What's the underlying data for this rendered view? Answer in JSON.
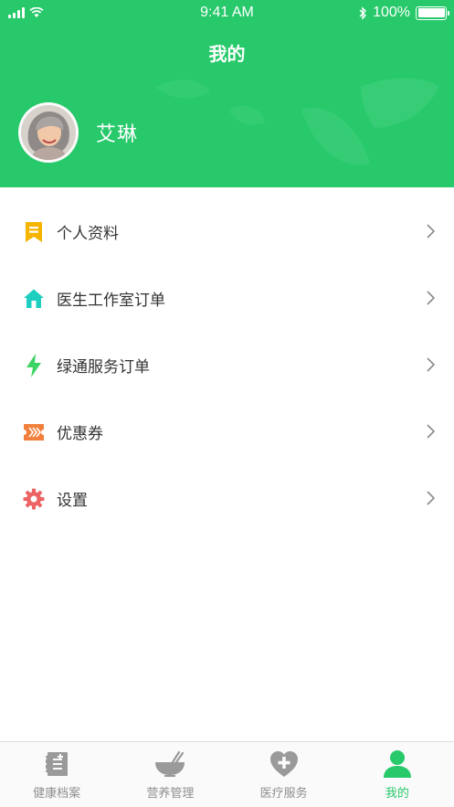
{
  "status_bar": {
    "time": "9:41 AM",
    "battery": "100%"
  },
  "header": {
    "title": "我的"
  },
  "profile": {
    "name": "艾琳"
  },
  "menu": [
    {
      "label": "个人资料",
      "icon": "bookmark-icon",
      "color": "#f5b400"
    },
    {
      "label": "医生工作室订单",
      "icon": "house-icon",
      "color": "#1ecfc0"
    },
    {
      "label": "绿通服务订单",
      "icon": "lightning-icon",
      "color": "#3ed463"
    },
    {
      "label": "优惠券",
      "icon": "ticket-icon",
      "color": "#f27f3c"
    },
    {
      "label": "设置",
      "icon": "gear-icon",
      "color": "#ec6464"
    }
  ],
  "tabbar": [
    {
      "label": "健康档案",
      "icon": "health-record-icon",
      "active": false
    },
    {
      "label": "营养管理",
      "icon": "bowl-icon",
      "active": false
    },
    {
      "label": "医疗服务",
      "icon": "medical-heart-icon",
      "active": false
    },
    {
      "label": "我的",
      "icon": "person-icon",
      "active": true
    }
  ],
  "colors": {
    "brand_green": "#27c96b",
    "inactive_gray": "#8f8f8f"
  }
}
